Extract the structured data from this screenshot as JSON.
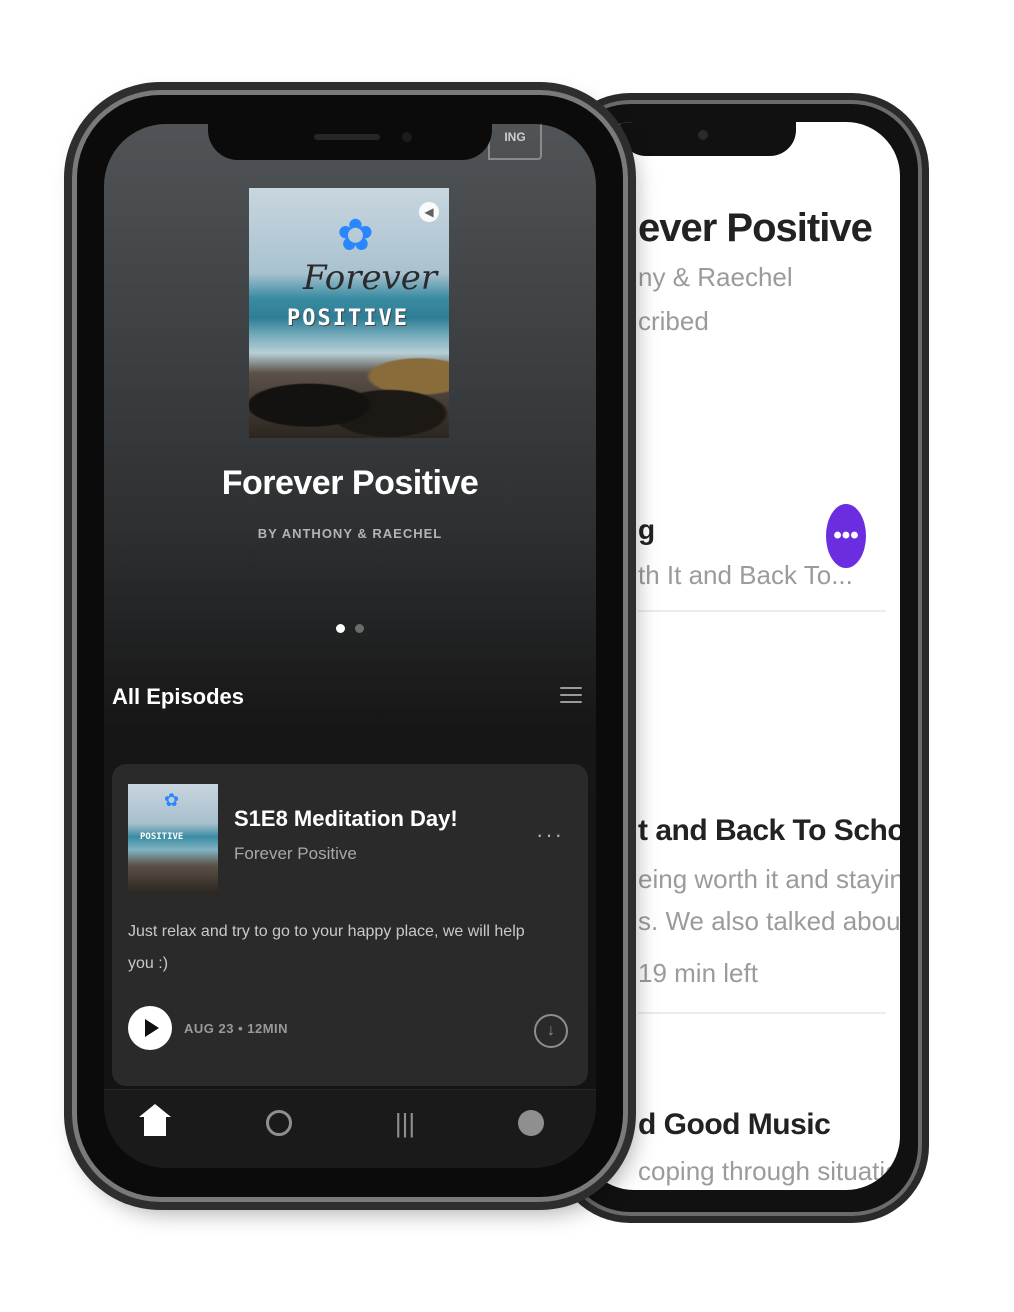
{
  "back_screen": {
    "title": "ever Positive",
    "author": "ny & Raechel",
    "subscribed": "cribed",
    "episode_1": {
      "title": "g",
      "desc": "th It and Back To..."
    },
    "more_label": "•••",
    "episode_2": {
      "title": "t and Back To School",
      "desc_line1": "eing worth it and staying",
      "desc_line2": "s. We also talked abou...",
      "time_left": "19 min left"
    },
    "episode_3": {
      "title": "d Good Music",
      "desc": "coping through situations"
    }
  },
  "front_screen": {
    "following_tab": "ING",
    "cover": {
      "script_word": "Forever",
      "block_word": "POSITIVE"
    },
    "show_title": "Forever Positive",
    "show_author": "BY ANTHONY & RAECHEL",
    "pager": {
      "count": 2,
      "active": 0
    },
    "section_title": "All Episodes",
    "episode": {
      "title": "S1E8 Meditation Day!",
      "show": "Forever Positive",
      "more": "···",
      "description": "Just relax and try to go to your happy place, we will help you :)",
      "meta": "AUG 23 • 12MIN"
    },
    "tabs": [
      "home-icon",
      "search-icon",
      "library-icon",
      "spotify-icon"
    ]
  },
  "colors": {
    "accent_purple": "#6a2de0",
    "dark_bg": "#121212",
    "card_bg": "#2a2a2a"
  }
}
